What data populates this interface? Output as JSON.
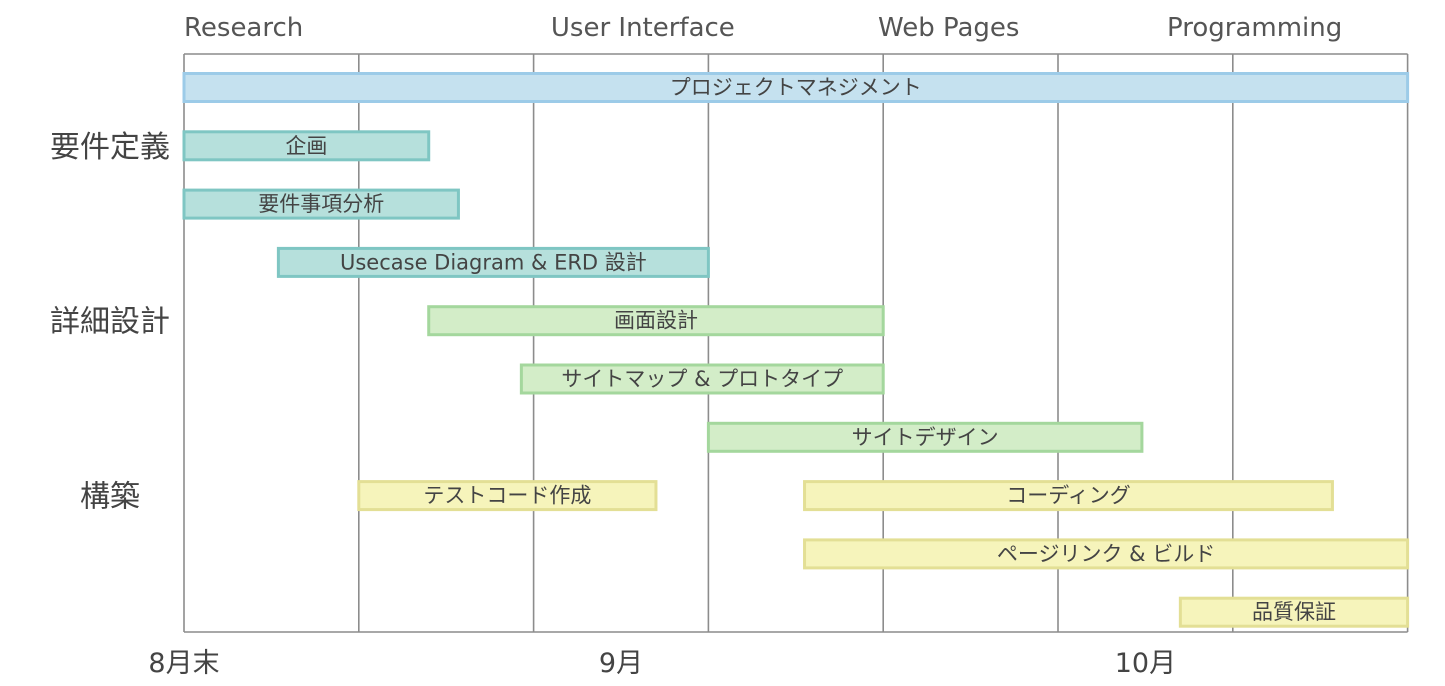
{
  "chart_data": {
    "type": "gantt",
    "phases": [
      "Research",
      "User Interface",
      "Web Pages",
      "Programming"
    ],
    "x_tick_labels": [
      {
        "label": "8月末",
        "week": 0
      },
      {
        "label": "9月",
        "week": 2.5
      },
      {
        "label": "10月",
        "week": 5.5
      }
    ],
    "week_range": [
      0,
      7
    ],
    "groups": [
      {
        "label": "要件定義",
        "row": 1
      },
      {
        "label": "詳細設計",
        "row": 4
      },
      {
        "label": "構築",
        "row": 7
      }
    ],
    "tasks": [
      {
        "name": "プロジェクトマネジメント",
        "row": 0,
        "start": 0.0,
        "end": 7.0,
        "group": "pm"
      },
      {
        "name": "企画",
        "row": 1,
        "start": 0.0,
        "end": 1.4,
        "group": "requirements"
      },
      {
        "name": "要件事項分析",
        "row": 2,
        "start": 0.0,
        "end": 1.57,
        "group": "requirements"
      },
      {
        "name": "Usecase Diagram & ERD 設計",
        "row": 3,
        "start": 0.54,
        "end": 3.0,
        "group": "requirements"
      },
      {
        "name": "画面設計",
        "row": 4,
        "start": 1.4,
        "end": 4.0,
        "group": "design"
      },
      {
        "name": "サイトマップ & プロトタイプ",
        "row": 5,
        "start": 1.93,
        "end": 4.0,
        "group": "design"
      },
      {
        "name": "サイトデザイン",
        "row": 6,
        "start": 3.0,
        "end": 5.48,
        "group": "design"
      },
      {
        "name": "テストコード作成",
        "row": 7,
        "start": 1.0,
        "end": 2.7,
        "group": "build"
      },
      {
        "name": "コーディング",
        "row": 7,
        "start": 3.55,
        "end": 6.57,
        "group": "build"
      },
      {
        "name": "ページリンク & ビルド",
        "row": 8,
        "start": 3.55,
        "end": 7.0,
        "group": "build"
      },
      {
        "name": "品質保証",
        "row": 9,
        "start": 5.7,
        "end": 7.0,
        "group": "build"
      }
    ],
    "colors": {
      "pm": {
        "fill": "#c5e1ef",
        "stroke": "#9ccbe8"
      },
      "requirements": {
        "fill": "#b6e0dc",
        "stroke": "#7fc6c3"
      },
      "design": {
        "fill": "#d3edc8",
        "stroke": "#a4d79d"
      },
      "build": {
        "fill": "#f6f4bb",
        "stroke": "#e3df95"
      },
      "grid": "#8c8c8c"
    },
    "grid": true
  }
}
